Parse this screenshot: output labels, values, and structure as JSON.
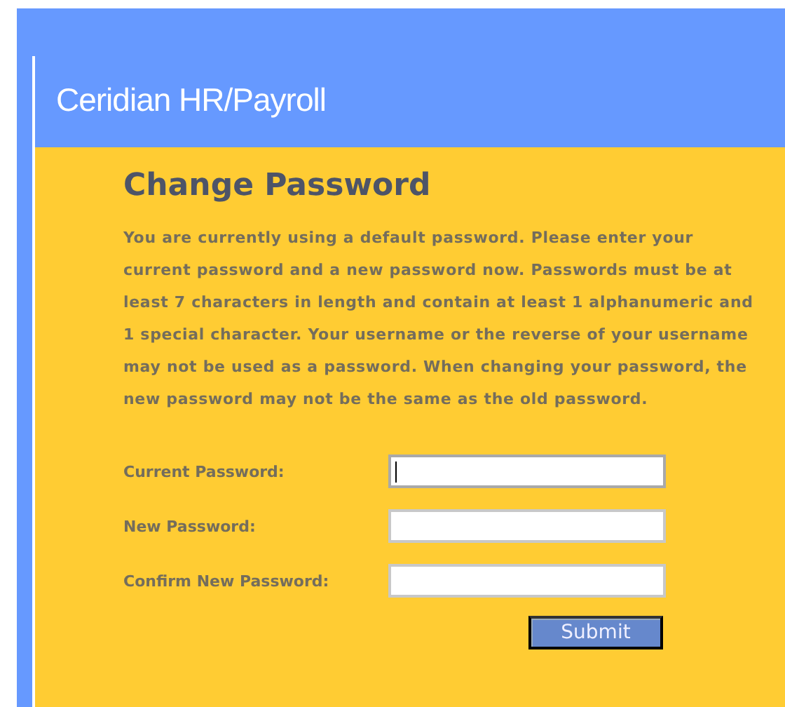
{
  "header": {
    "title": "Ceridian HR/Payroll"
  },
  "form": {
    "title": "Change Password",
    "instructions": "You are currently using a default password. Please enter your current password and a new password now. Passwords must be at least 7 characters in length and contain at least 1 alphanumeric and 1 special character. Your username or the reverse of your username may not be used as a password. When changing your password, the new password may not be the same as the old password.",
    "fields": [
      {
        "label": "Current Password:",
        "focused": true
      },
      {
        "label": "New Password:",
        "focused": false
      },
      {
        "label": "Confirm New Password:",
        "focused": false
      }
    ],
    "submit": "Submit"
  }
}
